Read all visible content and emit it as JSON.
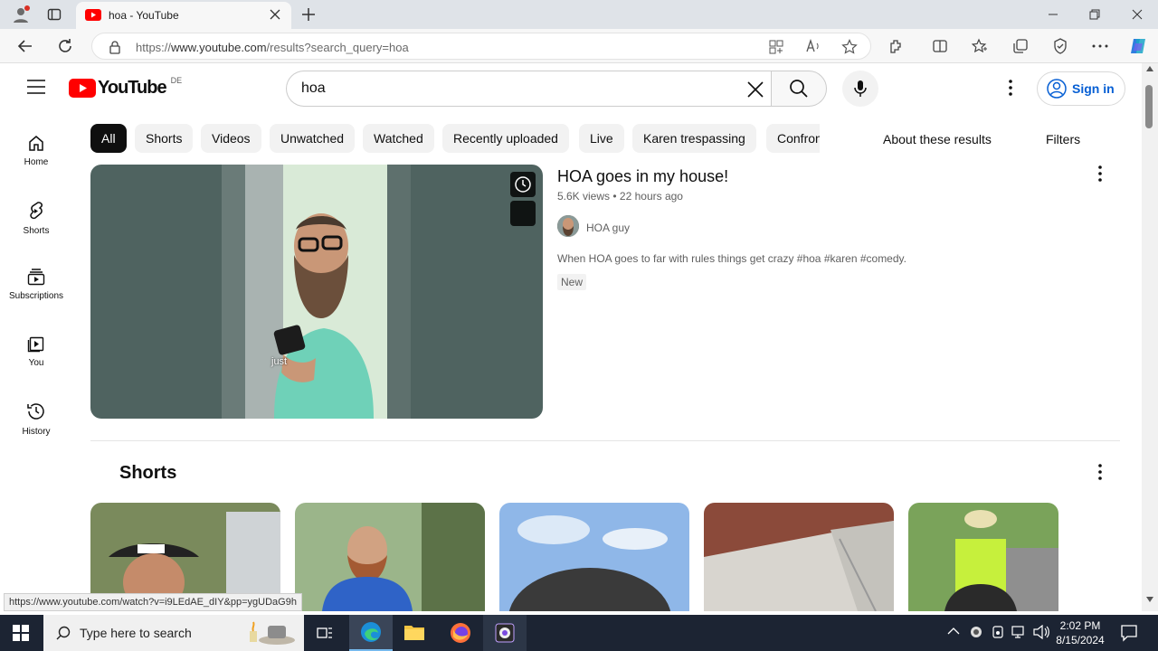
{
  "browser": {
    "tab_title": "hoa - YouTube",
    "url_prefix": "https://",
    "url_host": "www.youtube.com",
    "url_path": "/results?search_query=hoa",
    "status_url": "https://www.youtube.com/watch?v=i9LEdAE_dIY&pp=ygUDaG9h"
  },
  "youtube": {
    "logo_text": "YouTube",
    "logo_region": "DE",
    "search_query": "hoa",
    "signin_label": "Sign in",
    "nav": [
      {
        "label": "Home",
        "icon": "home-icon"
      },
      {
        "label": "Shorts",
        "icon": "shorts-icon"
      },
      {
        "label": "Subscriptions",
        "icon": "subscriptions-icon"
      },
      {
        "label": "You",
        "icon": "you-icon"
      },
      {
        "label": "History",
        "icon": "history-icon"
      }
    ],
    "chips": [
      "All",
      "Shorts",
      "Videos",
      "Unwatched",
      "Watched",
      "Recently uploaded",
      "Live",
      "Karen trespassing",
      "Confron"
    ],
    "about_results": "About these results",
    "filters": "Filters",
    "video": {
      "title": "HOA goes in my house!",
      "views": "5.6K views",
      "age": "22 hours ago",
      "channel": "HOA guy",
      "description": "When HOA goes to far with rules things get crazy #hoa #karen #comedy.",
      "badge": "New",
      "caption": "just"
    },
    "shorts_heading": "Shorts"
  },
  "taskbar": {
    "search_placeholder": "Type here to search",
    "time": "2:02 PM",
    "date": "8/15/2024"
  },
  "colors": {
    "yt_red": "#ff0000",
    "link_blue": "#065fd4",
    "taskbar": "#1c2433"
  }
}
